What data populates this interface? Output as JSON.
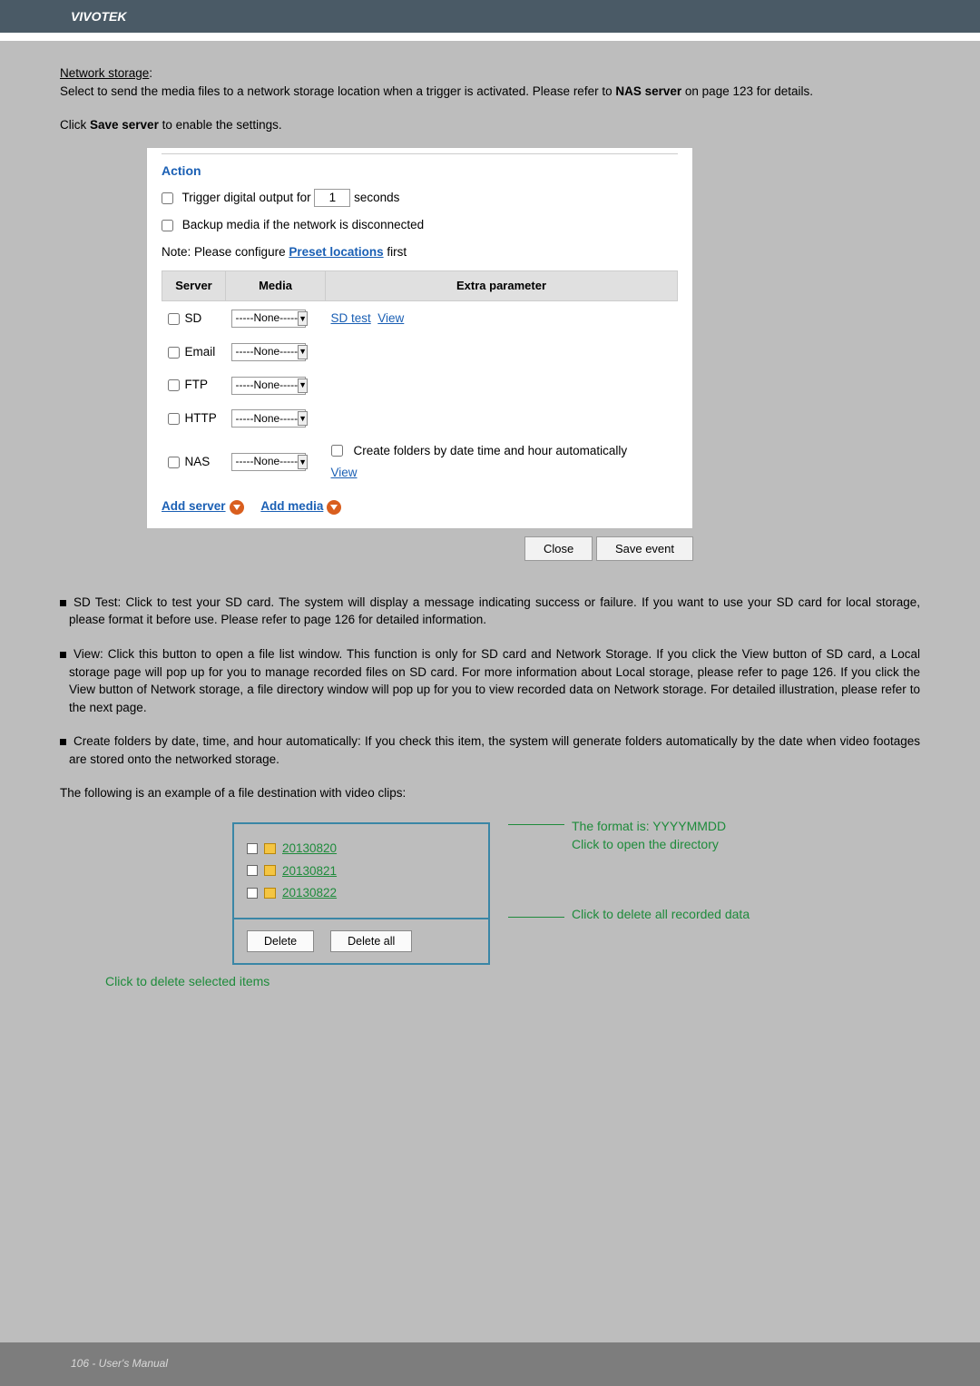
{
  "header": {
    "brand": "VIVOTEK"
  },
  "intro": {
    "heading": "Network storage",
    "line1a": "Select to send the media files to a network storage location when a trigger is activated. Please refer to ",
    "nas": "NAS server",
    "line1b": " on page 123 for details.",
    "click": "Click ",
    "saveServer": "Save server",
    "enable": " to enable the settings."
  },
  "panel": {
    "title": "Action",
    "triggerPre": "Trigger digital output for ",
    "triggerVal": "1",
    "seconds": " seconds",
    "backup": "Backup media if the network is disconnected",
    "notePre": "Note: Please configure ",
    "preset": "Preset locations",
    "notePost": " first",
    "headers": {
      "server": "Server",
      "media": "Media",
      "extra": "Extra parameter"
    },
    "noneOpt": "-----None-----",
    "rows": [
      {
        "name": "SD"
      },
      {
        "name": "Email"
      },
      {
        "name": "FTP"
      },
      {
        "name": "HTTP"
      },
      {
        "name": "NAS"
      }
    ],
    "sdTest": "SD test",
    "view": "View",
    "createFolders": "Create folders by date time and hour automatically",
    "addServer": "Add server",
    "addMedia": "Add media",
    "close": "Close",
    "saveEvent": "Save event"
  },
  "bullets": [
    "SD Test: Click to test your SD card. The system will display a message indicating success or failure. If you want to use your SD card for local storage, please format it before use. Please refer to page 126 for detailed information.",
    "View: Click this button to open a file list window. This function is only for SD card and Network Storage. If you click the View button of SD card, a Local storage page will pop up for you to manage recorded files on SD card. For more information about Local storage, please refer to page 126. If you click the View button of Network storage, a file directory window will pop up for you to view recorded data on Network storage. For detailed illustration, please refer to the next page.",
    "Create folders by date, time, and hour automatically: If you check this item, the system will generate folders automatically by the date when video footages are stored onto the networked storage."
  ],
  "exampleIntro": "The following is an example of a file destination with video clips:",
  "folders": [
    "20130820",
    "20130821",
    "20130822"
  ],
  "exButtons": {
    "delete": "Delete",
    "deleteAll": "Delete all"
  },
  "annotations": {
    "format": "The format is: YYYYMMDD",
    "open": "Click to open the directory",
    "deleteAll": "Click to delete all recorded data",
    "deleteSel": "Click to delete selected items"
  },
  "footer": "106 - User's Manual"
}
